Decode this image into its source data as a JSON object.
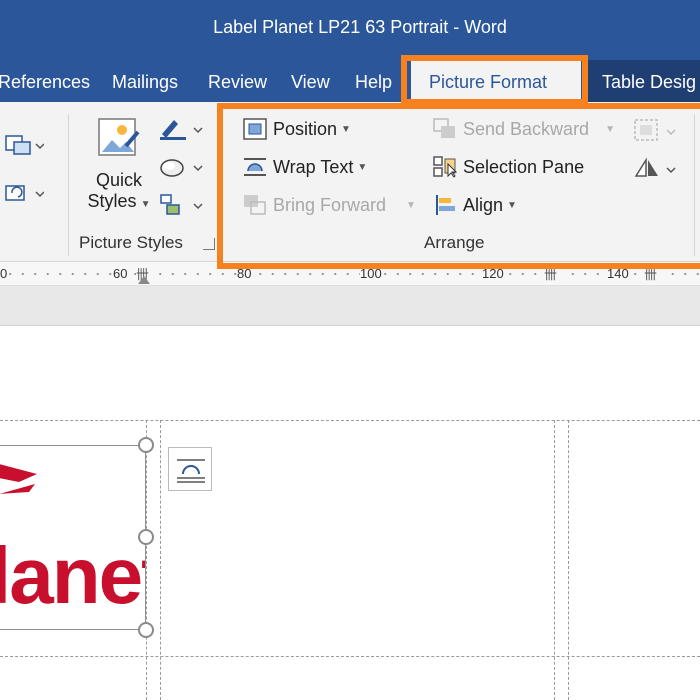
{
  "window": {
    "title": "Label Planet LP21 63 Portrait  -  Word"
  },
  "tabs": [
    {
      "label": "References"
    },
    {
      "label": "Mailings"
    },
    {
      "label": "Review"
    },
    {
      "label": "View"
    },
    {
      "label": "Help"
    },
    {
      "label": "Picture Format"
    },
    {
      "label": "Table Desig"
    }
  ],
  "ribbon": {
    "picture_styles": {
      "quick_styles_line1": "Quick",
      "quick_styles_line2": "Styles",
      "group_label": "Picture Styles"
    },
    "arrange": {
      "position": "Position",
      "wrap_text": "Wrap Text",
      "bring_forward": "Bring Forward",
      "send_backward": "Send Backward",
      "selection_pane": "Selection Pane",
      "align": "Align",
      "group_label": "Arrange"
    }
  },
  "ruler": {
    "labels": [
      "60",
      "80",
      "100",
      "120",
      "140"
    ],
    "start_label": "0"
  },
  "document": {
    "logo_text": "lanet"
  },
  "colors": {
    "title_bar": "#2b579a",
    "highlight": "#f5821f",
    "logo_red": "#c8102e"
  }
}
